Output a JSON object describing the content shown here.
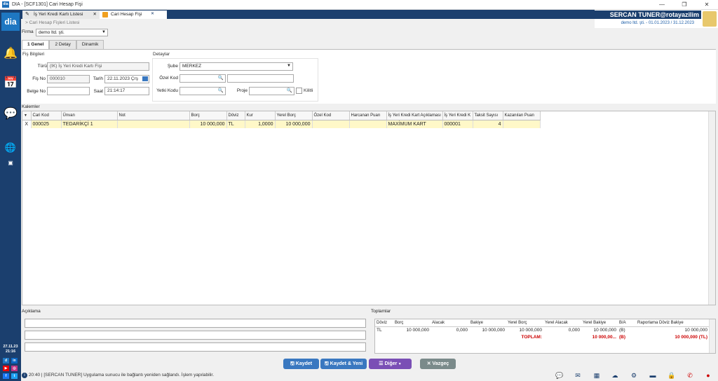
{
  "window": {
    "title": "DIA - [SCF1301] Cari Hesap Fişi",
    "app_icon": "dia",
    "controls": [
      "—",
      "❐",
      "✕"
    ]
  },
  "sidebar": {
    "logo": "dia",
    "date": "27.11.23",
    "time": "21:16"
  },
  "doc_tabs": [
    {
      "label": "İş Yeri Kredi Kartı Listesi",
      "close": "✕"
    },
    {
      "label": "Cari Hesap Fişi",
      "close": "✕"
    }
  ],
  "user": {
    "name": "SERCAN TUNER@rotayazilim",
    "period": "demo ltd. şti. -  01.01.2023 / 31.12.2023"
  },
  "breadcrumb": "> Cari Hesap Fişleri Listesi",
  "firma": {
    "label": "Firma",
    "value": "demo ltd. şti."
  },
  "page_tabs": [
    "1 Genel",
    "2 Detay",
    "Dinamik"
  ],
  "fis_bilgileri": {
    "title": "Fiş Bilgileri",
    "turu_label": "Türü",
    "turu": "(IK) İş Yeri Kredi Kartı Fişi",
    "fisno_label": "Fiş No",
    "fisno": "000010",
    "tarih_label": "Tarih",
    "tarih": "22.11.2023 Çrş",
    "belgeno_label": "Belge No",
    "belgeno": "",
    "saat_label": "Saat",
    "saat": "21:14:17"
  },
  "detaylar": {
    "title": "Detaylar",
    "sube_label": "Şube",
    "sube": "MERKEZ",
    "ozelkod_label": "Özel Kod",
    "yetkikodu_label": "Yetki Kodu",
    "proje_label": "Proje",
    "kilitli_label": "Kilitli"
  },
  "kalemler": {
    "title": "Kalemler",
    "columns": [
      "Cari Kod",
      "Ünvan",
      "Not",
      "Borç",
      "Döviz",
      "Kur",
      "Yerel Borç",
      "Özel Kod",
      "Harcanan Puan",
      "İş Yeri Kredi Kart Açıklaması",
      "İş Yeri Kredi K",
      "Taksit Sayısı",
      "Kazanılan Puan"
    ],
    "rows": [
      {
        "marker": "X",
        "cari_kod": "000025",
        "unvan": "TEDARİKÇİ 1",
        "not": "",
        "borc": "10 000,000",
        "doviz": "TL",
        "kur": "1,0000",
        "yerel_borc": "10 000,000",
        "ozel_kod": "",
        "harcanan_puan": "",
        "aciklama": "MAXİMUM KART",
        "kredi_k": "000001",
        "taksit": "4",
        "kazanilan": ""
      }
    ]
  },
  "aciklama": {
    "title": "Açıklama"
  },
  "toplamlar": {
    "title": "Toplamlar",
    "columns": [
      "Döviz",
      "Borç",
      "Alacak",
      "Bakiye",
      "Yerel Borç",
      "Yerel Alacak",
      "Yerel Bakiye",
      "B/A",
      "Raporlama Döviz Bakiye"
    ],
    "row": [
      "TL",
      "10 000,000",
      "0,000",
      "10 000,000",
      "10 000,000",
      "0,000",
      "10 000,000",
      "(B)",
      "10 000,000"
    ],
    "total_label": "TOPLAM:",
    "total_value": "10 000,00...",
    "total_ba": "(B)",
    "total_rapor": "10 000,000 (TL)"
  },
  "buttons": {
    "kaydet": "Kaydet",
    "kaydet_yeni": "Kaydet & Yeni",
    "diger": "Diğer",
    "vazgec": "Vazgeç"
  },
  "status": "20:40 | [SERCAN TUNER] Uygulama sunucu ile bağlantı yeniden sağlandı. İşlem yapılabilir.",
  "colors": {
    "navy": "#1b3f6e",
    "blue": "#3a78c0",
    "purple": "#7a4fb5",
    "grey": "#7a8a8a",
    "highlight": "#fff8c8"
  }
}
